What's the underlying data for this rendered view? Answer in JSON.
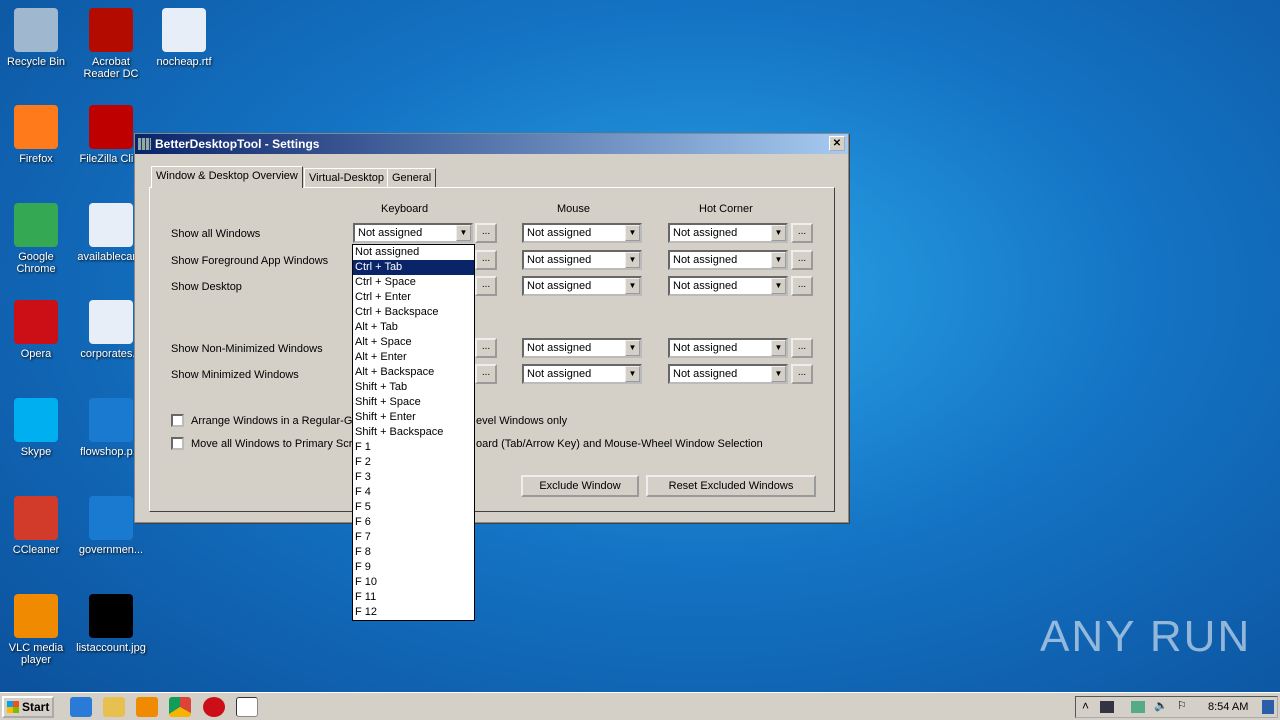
{
  "desktop": {
    "icons": [
      {
        "label": "Recycle Bin",
        "color": "#9fb8d0"
      },
      {
        "label": "Acrobat Reader DC",
        "color": "#b30b00"
      },
      {
        "label": "nocheap.rtf",
        "color": "#e8eef8"
      },
      {
        "label": "Firefox",
        "color": "#ff7a1a"
      },
      {
        "label": "FileZilla Cli...",
        "color": "#bf0000"
      },
      {
        "label": "Google Chrome",
        "color": "#34a853"
      },
      {
        "label": "availablecar...",
        "color": "#e8eef8"
      },
      {
        "label": "Opera",
        "color": "#cc0f16"
      },
      {
        "label": "corporates...",
        "color": "#e8eef8"
      },
      {
        "label": "Skype",
        "color": "#00aff0"
      },
      {
        "label": "flowshop.p...",
        "color": "#1a7ad0"
      },
      {
        "label": "CCleaner",
        "color": "#d23a2a"
      },
      {
        "label": "governmen...",
        "color": "#1a7ad0"
      },
      {
        "label": "VLC media player",
        "color": "#f08a00"
      },
      {
        "label": "listaccount.jpg",
        "color": "#000000"
      }
    ]
  },
  "window": {
    "title": "BetterDesktopTool - Settings",
    "close": "✕",
    "tabs": [
      "Window & Desktop Overview",
      "Virtual-Desktop",
      "General"
    ],
    "columns": [
      "Keyboard",
      "Mouse",
      "Hot Corner"
    ],
    "rows": [
      {
        "label": "Show all Windows",
        "keyboard": "Not assigned",
        "mouse": "Not assigned",
        "corner": "Not assigned"
      },
      {
        "label": "Show Foreground App Windows",
        "mouse": "Not assigned",
        "corner": "Not assigned"
      },
      {
        "label": "Show Desktop",
        "mouse": "Not assigned",
        "corner": "Not assigned"
      },
      {
        "label": "Show Non-Minimized Windows",
        "mouse": "Not assigned",
        "corner": "Not assigned"
      },
      {
        "label": "Show Minimized Windows",
        "mouse": "Not assigned",
        "corner": "Not assigned"
      }
    ],
    "dots": "...",
    "check1_a": "Arrange Windows in a Regular-Gri",
    "check1_b": "evel Windows only",
    "check2_a": "Move all Windows to Primary Scre",
    "check2_b": "oard (Tab/Arrow Key) and Mouse-Wheel Window Selection",
    "exclude": "Exclude Window",
    "reset": "Reset Excluded Windows"
  },
  "dropdown": {
    "selected_index": 1,
    "options": [
      "Not assigned",
      "Ctrl + Tab",
      "Ctrl + Space",
      "Ctrl + Enter",
      "Ctrl + Backspace",
      "Alt + Tab",
      "Alt + Space",
      "Alt + Enter",
      "Alt + Backspace",
      "Shift + Tab",
      "Shift + Space",
      "Shift + Enter",
      "Shift + Backspace",
      "F 1",
      "F 2",
      "F 3",
      "F 4",
      "F 5",
      "F 6",
      "F 7",
      "F 8",
      "F 9",
      "F 10",
      "F 11",
      "F 12"
    ]
  },
  "taskbar": {
    "start": "Start",
    "clock": "8:54 AM",
    "tray_expand": "˄"
  },
  "watermark": "ANY RUN"
}
